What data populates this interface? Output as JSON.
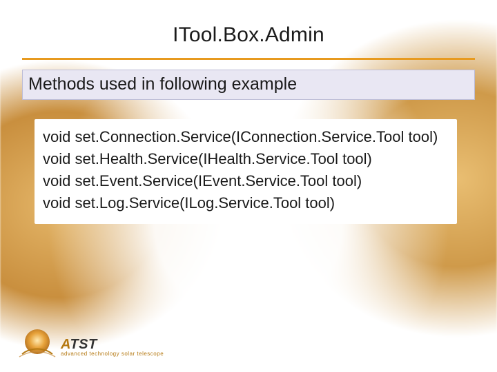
{
  "title": "ITool.Box.Admin",
  "section_heading": "Methods used in following example",
  "code_lines": [
    "void set.Connection.Service(IConnection.Service.Tool tool)",
    "void set.Health.Service(IHealth.Service.Tool tool)",
    "void set.Event.Service(IEvent.Service.Tool tool)",
    "void set.Log.Service(ILog.Service.Tool tool)"
  ],
  "logo": {
    "acronym_a": "A",
    "acronym_rest": "TST",
    "subtitle": "advanced technology solar telescope"
  },
  "colors": {
    "accent": "#e79a1f",
    "section_bg": "#e9e7f3",
    "logo_orange": "#b57912"
  }
}
